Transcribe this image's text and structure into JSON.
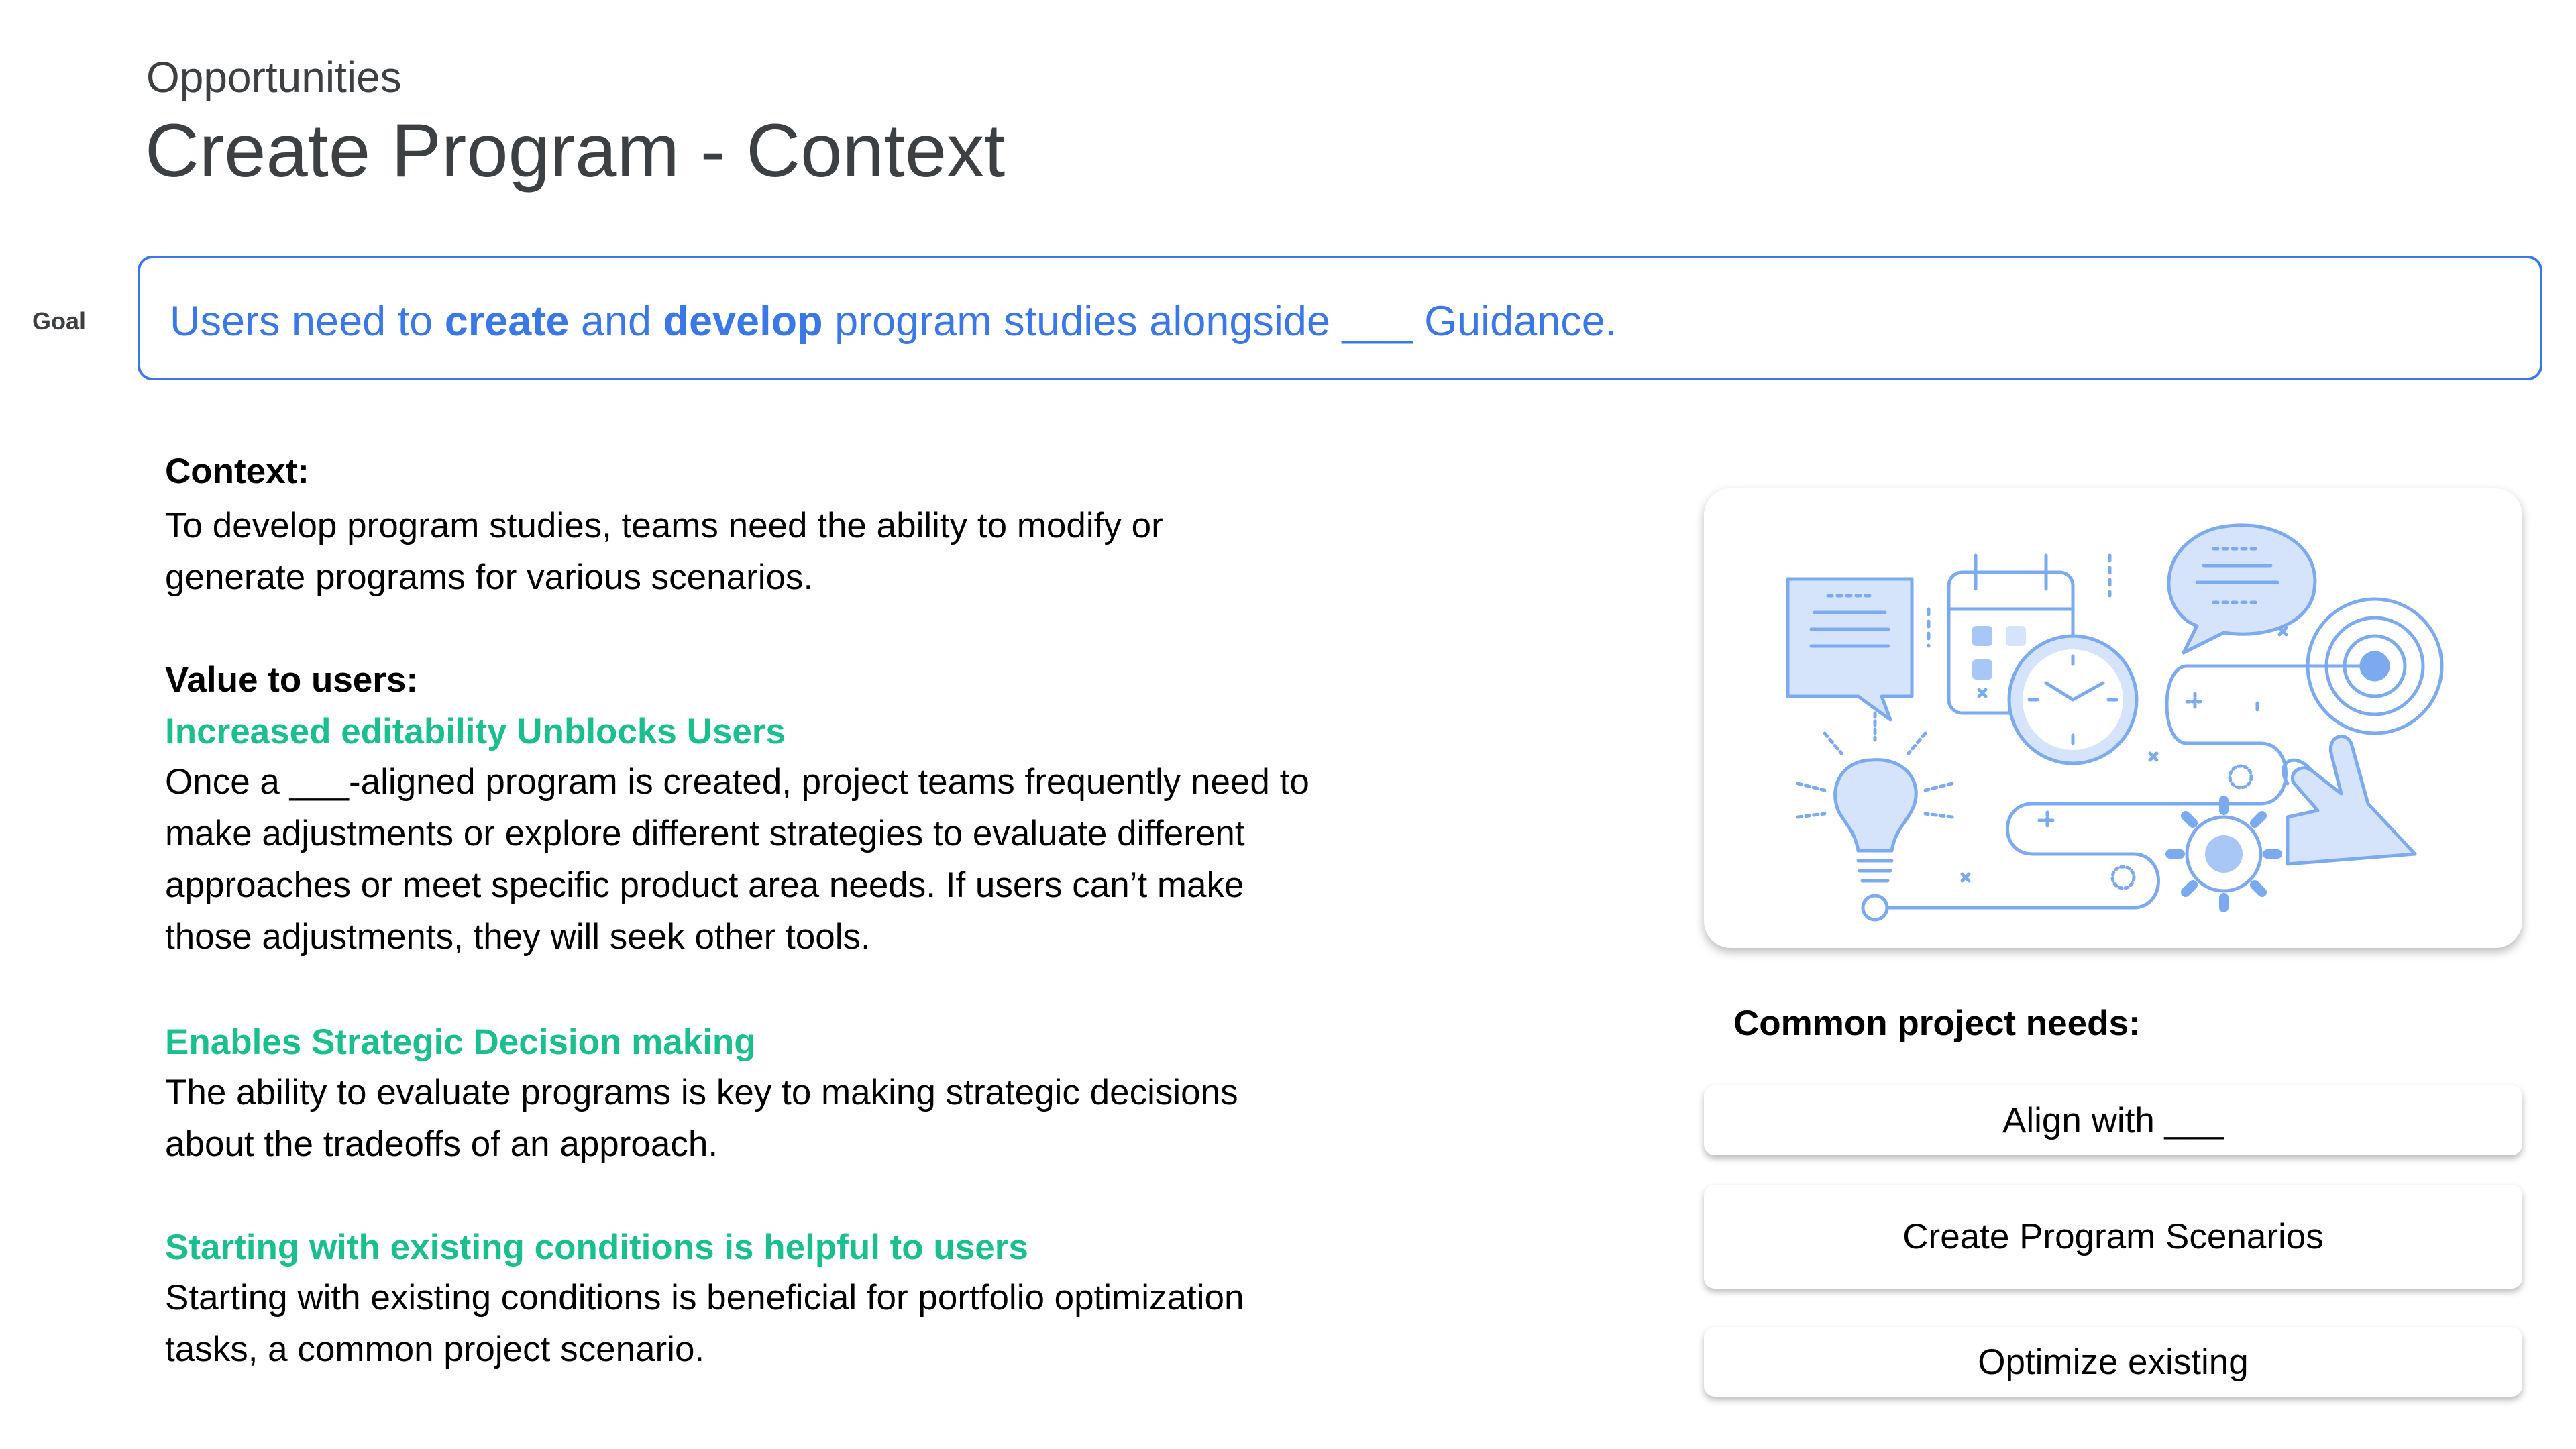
{
  "header": {
    "breadcrumb": "Opportunities",
    "title": "Create Program - Context"
  },
  "goal": {
    "label": "Goal",
    "text_1": "Users need to ",
    "bold_1": "create",
    "text_2": " and ",
    "bold_2": "develop",
    "text_3": " program studies alongside ___ Guidance."
  },
  "context": {
    "heading": "Context:",
    "body": "To develop program studies, teams need the ability to modify or generate programs for various scenarios."
  },
  "value": {
    "heading": "Value to users:",
    "items": [
      {
        "title": "Increased editability Unblocks Users",
        "body": "Once a ___-aligned program is created, project teams frequently need to make adjustments or explore different strategies to evaluate different approaches or meet specific product area needs. If users can’t make those adjustments, they will seek other tools."
      },
      {
        "title": "Enables Strategic Decision making",
        "body": "The ability to evaluate programs is key to making strategic decisions about the tradeoffs of an approach."
      },
      {
        "title": "Starting with existing conditions is helpful to users",
        "body": "Starting with existing conditions is beneficial for portfolio optimization tasks, a common project scenario."
      }
    ]
  },
  "needs": {
    "heading": "Common project needs:",
    "items": [
      "Align with ___",
      "Create Program Scenarios",
      "Optimize existing"
    ]
  },
  "colors": {
    "accent_blue": "#3b78e7",
    "accent_green": "#1bbf8f",
    "illustration_blue": "#7baaf0",
    "illustration_fill": "#d6e4fb"
  }
}
